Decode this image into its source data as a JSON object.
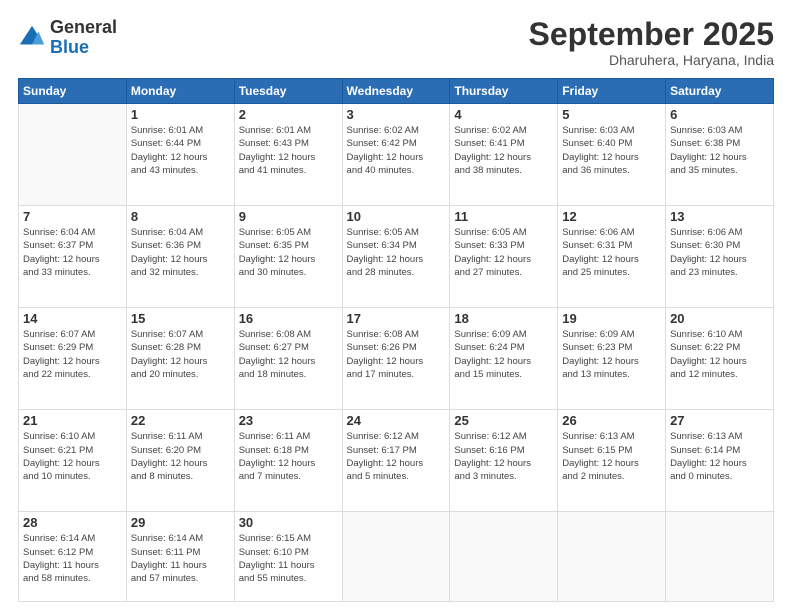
{
  "header": {
    "logo": {
      "general": "General",
      "blue": "Blue"
    },
    "title": "September 2025",
    "location": "Dharuhera, Haryana, India"
  },
  "weekdays": [
    "Sunday",
    "Monday",
    "Tuesday",
    "Wednesday",
    "Thursday",
    "Friday",
    "Saturday"
  ],
  "weeks": [
    [
      {
        "day": null,
        "info": null
      },
      {
        "day": "1",
        "info": "Sunrise: 6:01 AM\nSunset: 6:44 PM\nDaylight: 12 hours\nand 43 minutes."
      },
      {
        "day": "2",
        "info": "Sunrise: 6:01 AM\nSunset: 6:43 PM\nDaylight: 12 hours\nand 41 minutes."
      },
      {
        "day": "3",
        "info": "Sunrise: 6:02 AM\nSunset: 6:42 PM\nDaylight: 12 hours\nand 40 minutes."
      },
      {
        "day": "4",
        "info": "Sunrise: 6:02 AM\nSunset: 6:41 PM\nDaylight: 12 hours\nand 38 minutes."
      },
      {
        "day": "5",
        "info": "Sunrise: 6:03 AM\nSunset: 6:40 PM\nDaylight: 12 hours\nand 36 minutes."
      },
      {
        "day": "6",
        "info": "Sunrise: 6:03 AM\nSunset: 6:38 PM\nDaylight: 12 hours\nand 35 minutes."
      }
    ],
    [
      {
        "day": "7",
        "info": "Sunrise: 6:04 AM\nSunset: 6:37 PM\nDaylight: 12 hours\nand 33 minutes."
      },
      {
        "day": "8",
        "info": "Sunrise: 6:04 AM\nSunset: 6:36 PM\nDaylight: 12 hours\nand 32 minutes."
      },
      {
        "day": "9",
        "info": "Sunrise: 6:05 AM\nSunset: 6:35 PM\nDaylight: 12 hours\nand 30 minutes."
      },
      {
        "day": "10",
        "info": "Sunrise: 6:05 AM\nSunset: 6:34 PM\nDaylight: 12 hours\nand 28 minutes."
      },
      {
        "day": "11",
        "info": "Sunrise: 6:05 AM\nSunset: 6:33 PM\nDaylight: 12 hours\nand 27 minutes."
      },
      {
        "day": "12",
        "info": "Sunrise: 6:06 AM\nSunset: 6:31 PM\nDaylight: 12 hours\nand 25 minutes."
      },
      {
        "day": "13",
        "info": "Sunrise: 6:06 AM\nSunset: 6:30 PM\nDaylight: 12 hours\nand 23 minutes."
      }
    ],
    [
      {
        "day": "14",
        "info": "Sunrise: 6:07 AM\nSunset: 6:29 PM\nDaylight: 12 hours\nand 22 minutes."
      },
      {
        "day": "15",
        "info": "Sunrise: 6:07 AM\nSunset: 6:28 PM\nDaylight: 12 hours\nand 20 minutes."
      },
      {
        "day": "16",
        "info": "Sunrise: 6:08 AM\nSunset: 6:27 PM\nDaylight: 12 hours\nand 18 minutes."
      },
      {
        "day": "17",
        "info": "Sunrise: 6:08 AM\nSunset: 6:26 PM\nDaylight: 12 hours\nand 17 minutes."
      },
      {
        "day": "18",
        "info": "Sunrise: 6:09 AM\nSunset: 6:24 PM\nDaylight: 12 hours\nand 15 minutes."
      },
      {
        "day": "19",
        "info": "Sunrise: 6:09 AM\nSunset: 6:23 PM\nDaylight: 12 hours\nand 13 minutes."
      },
      {
        "day": "20",
        "info": "Sunrise: 6:10 AM\nSunset: 6:22 PM\nDaylight: 12 hours\nand 12 minutes."
      }
    ],
    [
      {
        "day": "21",
        "info": "Sunrise: 6:10 AM\nSunset: 6:21 PM\nDaylight: 12 hours\nand 10 minutes."
      },
      {
        "day": "22",
        "info": "Sunrise: 6:11 AM\nSunset: 6:20 PM\nDaylight: 12 hours\nand 8 minutes."
      },
      {
        "day": "23",
        "info": "Sunrise: 6:11 AM\nSunset: 6:18 PM\nDaylight: 12 hours\nand 7 minutes."
      },
      {
        "day": "24",
        "info": "Sunrise: 6:12 AM\nSunset: 6:17 PM\nDaylight: 12 hours\nand 5 minutes."
      },
      {
        "day": "25",
        "info": "Sunrise: 6:12 AM\nSunset: 6:16 PM\nDaylight: 12 hours\nand 3 minutes."
      },
      {
        "day": "26",
        "info": "Sunrise: 6:13 AM\nSunset: 6:15 PM\nDaylight: 12 hours\nand 2 minutes."
      },
      {
        "day": "27",
        "info": "Sunrise: 6:13 AM\nSunset: 6:14 PM\nDaylight: 12 hours\nand 0 minutes."
      }
    ],
    [
      {
        "day": "28",
        "info": "Sunrise: 6:14 AM\nSunset: 6:12 PM\nDaylight: 11 hours\nand 58 minutes."
      },
      {
        "day": "29",
        "info": "Sunrise: 6:14 AM\nSunset: 6:11 PM\nDaylight: 11 hours\nand 57 minutes."
      },
      {
        "day": "30",
        "info": "Sunrise: 6:15 AM\nSunset: 6:10 PM\nDaylight: 11 hours\nand 55 minutes."
      },
      {
        "day": null,
        "info": null
      },
      {
        "day": null,
        "info": null
      },
      {
        "day": null,
        "info": null
      },
      {
        "day": null,
        "info": null
      }
    ]
  ]
}
